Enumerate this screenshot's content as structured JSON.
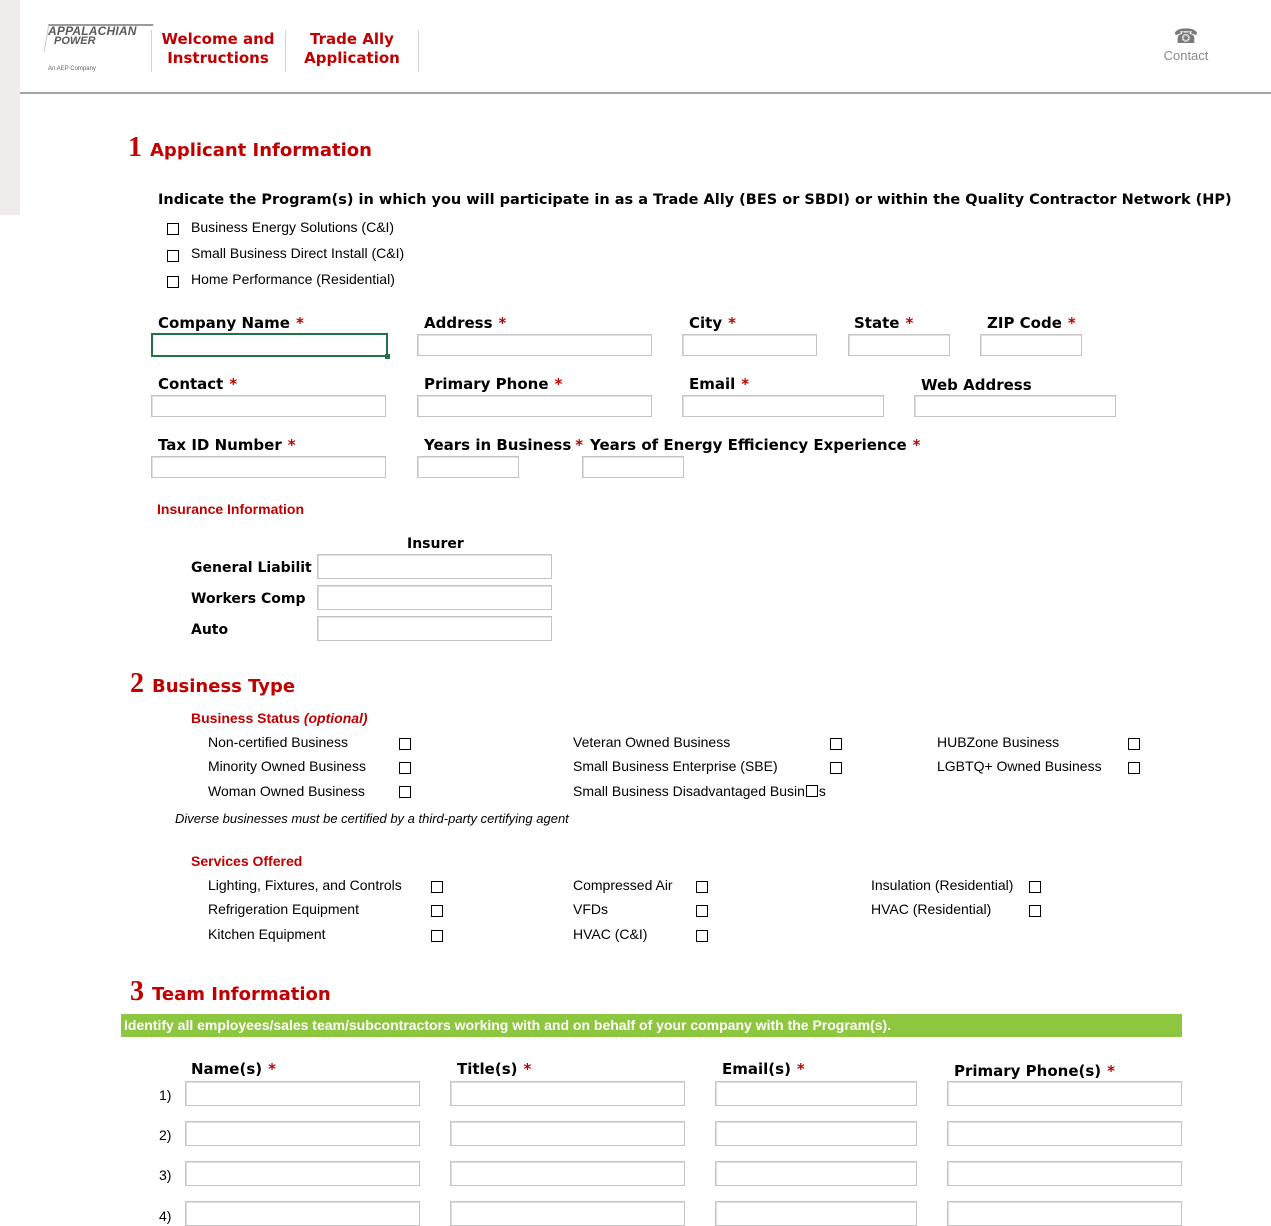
{
  "header": {
    "logo": {
      "line1": "APPALACHIAN",
      "line2": "POWER",
      "line3": "An AEP Company"
    },
    "nav": [
      {
        "line1": "Welcome and",
        "line2": "Instructions"
      },
      {
        "line1": "Trade Ally",
        "line2": "Application"
      }
    ],
    "contact": {
      "icon": "phone-icon",
      "label": "Contact"
    }
  },
  "sections": {
    "s1": {
      "num": "1",
      "title": "Applicant Information"
    },
    "s2": {
      "num": "2",
      "title": "Business Type"
    },
    "s3": {
      "num": "3",
      "title": "Team Information"
    }
  },
  "applicant": {
    "program_prompt": "Indicate the Program(s) in which you will participate in as a Trade Ally (BES or SBDI) or within the Quality Contractor Network (HP)",
    "programs": [
      "Business Energy Solutions (C&I)",
      "Small Business Direct Install (C&I)",
      "Home Performance (Residential)"
    ],
    "fields": {
      "company_name": "Company Name",
      "address": "Address",
      "city": "City",
      "state": "State",
      "zip": "ZIP Code",
      "contact": "Contact",
      "primary_phone": "Primary Phone",
      "email": "Email",
      "web_address": "Web Address",
      "tax_id": "Tax ID Number",
      "years_business": "Years in Business",
      "years_ee": "Years of Energy Efficiency Experience"
    },
    "required_mark": "*",
    "insurance": {
      "title": "Insurance Information",
      "insurer_header": "Insurer",
      "rows": [
        "General Liabilit",
        "Workers Comp",
        "Auto"
      ]
    }
  },
  "business": {
    "status_title": "Business Status",
    "status_optional": "(optional)",
    "status": [
      "Non-certified Business",
      "Veteran Owned Business",
      "HUBZone Business",
      "Minority Owned Business",
      "Small Business Enterprise (SBE)",
      "LGBTQ+ Owned Business",
      "Woman Owned Business",
      "Small Business Disadvantaged Busin",
      "s"
    ],
    "note": "Diverse businesses must be certified by a third-party certifying agent",
    "services_title": "Services Offered",
    "services": [
      "Lighting, Fixtures, and Controls",
      "Compressed Air",
      "Insulation (Residential)",
      "Refrigeration Equipment",
      "VFDs",
      "HVAC (Residential)",
      "Kitchen Equipment",
      "HVAC (C&I)"
    ]
  },
  "team": {
    "banner": "Identify all employees/sales team/subcontractors working with and on behalf of your company with the Program(s).",
    "cols": [
      "Name(s)",
      "Title(s)",
      "Email(s)",
      "Primary Phone(s)"
    ],
    "rows": [
      "1)",
      "2)",
      "3)",
      "4)"
    ]
  }
}
